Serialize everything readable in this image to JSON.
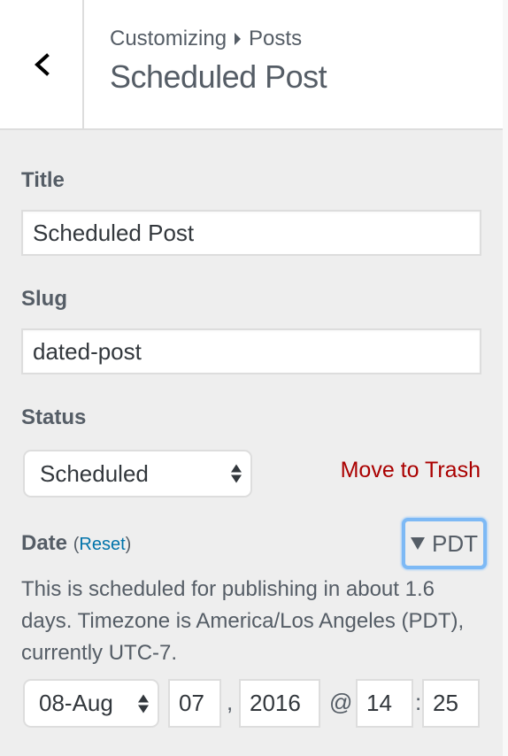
{
  "header": {
    "back_icon": "chevron-left-icon",
    "breadcrumb": {
      "root": "Customizing",
      "separator_icon": "caret-right-icon",
      "section": "Posts"
    },
    "title": "Scheduled Post"
  },
  "fields": {
    "title": {
      "label": "Title",
      "value": "Scheduled Post"
    },
    "slug": {
      "label": "Slug",
      "value": "dated-post"
    },
    "status": {
      "label": "Status",
      "selected": "Scheduled",
      "trash_link": "Move to Trash"
    },
    "date": {
      "label": "Date",
      "reset_open": "(",
      "reset_label": "Reset",
      "reset_close": ")",
      "timezone_toggle": "PDT",
      "description": "This is scheduled for publishing in about 1.6 days. Timezone is America/Los Angeles (PDT), currently UTC-7.",
      "month": "08-Aug",
      "day": "07",
      "comma": ",",
      "year": "2016",
      "at": "@",
      "hour": "14",
      "colon": ":",
      "minute": "25"
    }
  },
  "colors": {
    "panel_bg": "#eeeeee",
    "trash_red": "#aa0000",
    "link_blue": "#0073aa",
    "focus_ring": "#7db9f5"
  }
}
